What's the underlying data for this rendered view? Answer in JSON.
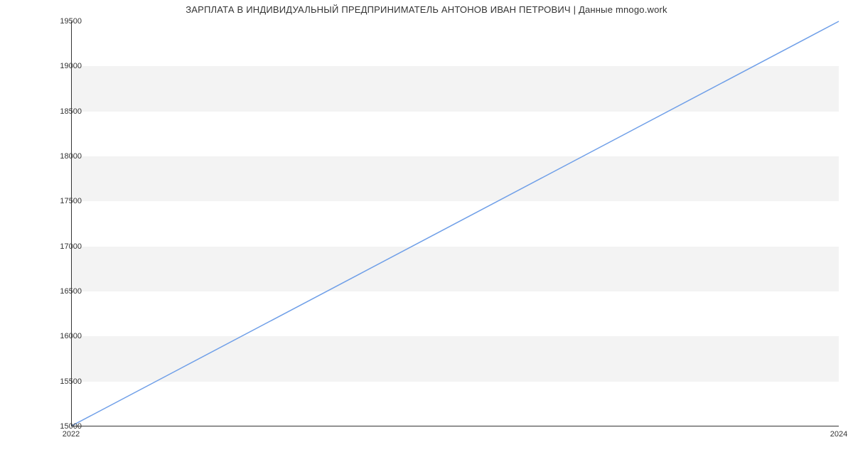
{
  "chart_data": {
    "type": "line",
    "title": "ЗАРПЛАТА В ИНДИВИДУАЛЬНЫЙ ПРЕДПРИНИМАТЕЛЬ АНТОНОВ ИВАН ПЕТРОВИЧ | Данные mnogo.work",
    "x": [
      2022,
      2024
    ],
    "values": [
      15000,
      19500
    ],
    "x_ticks": [
      2022,
      2024
    ],
    "y_ticks": [
      15000,
      15500,
      16000,
      16500,
      17000,
      17500,
      18000,
      18500,
      19000,
      19500
    ],
    "xlim": [
      2022,
      2024
    ],
    "ylim": [
      15000,
      19500
    ],
    "xlabel": "",
    "ylabel": "",
    "line_color": "#6f9fe8",
    "band_color": "#f3f3f3"
  }
}
